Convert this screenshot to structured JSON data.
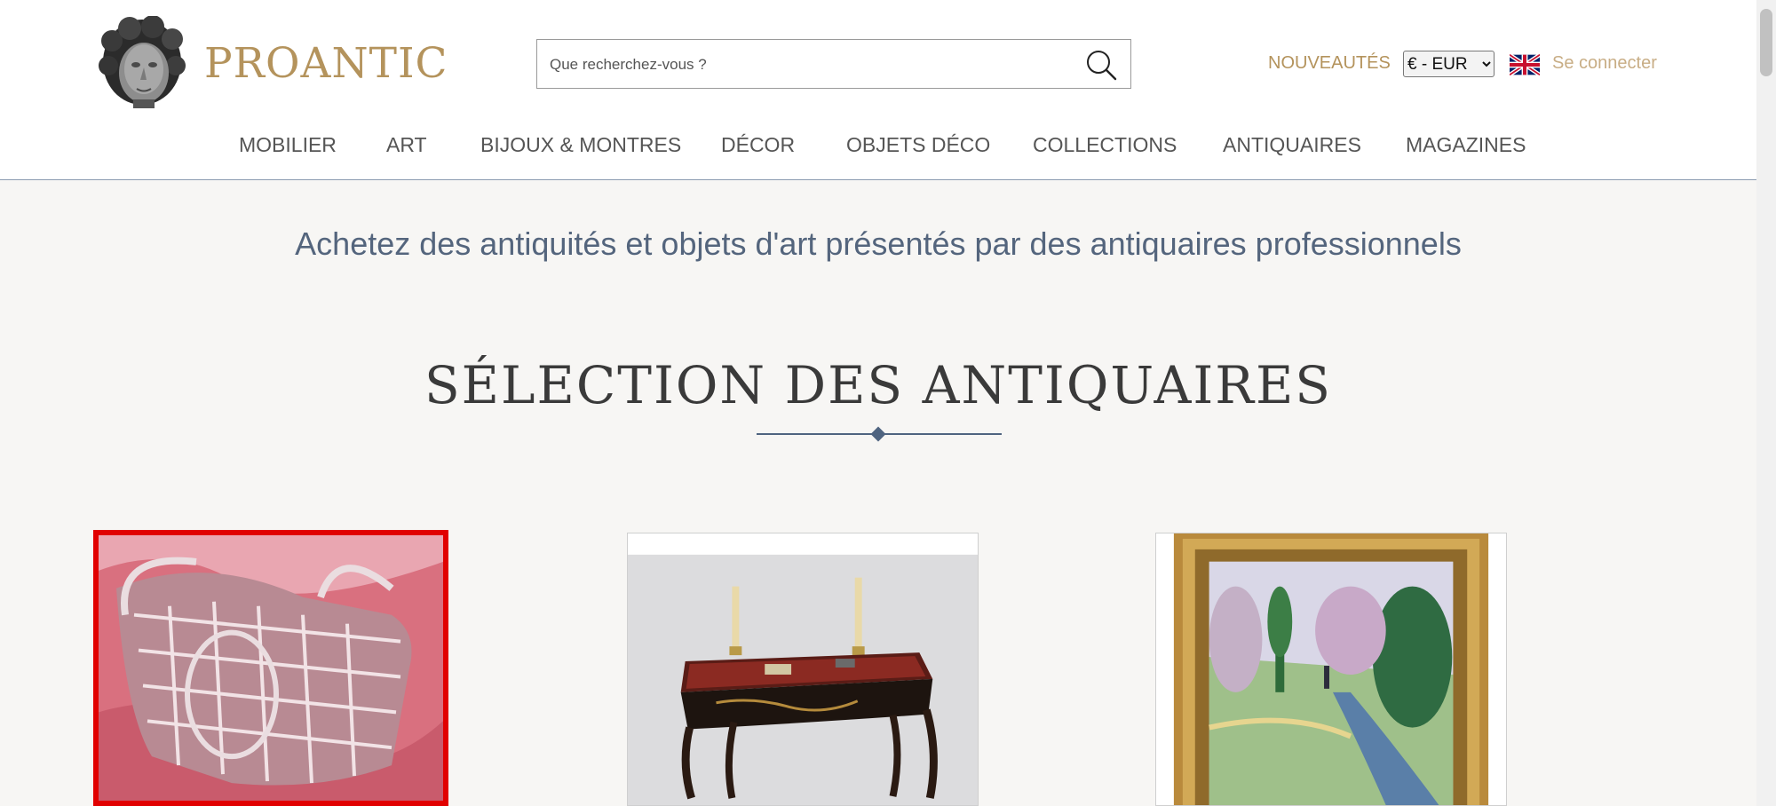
{
  "header": {
    "logo_text": "PROANTIC",
    "search_placeholder": "Que recherchez-vous ?",
    "new_link": "NOUVEAUTÉS",
    "currency": {
      "selected": "€ - EUR",
      "options": [
        "€ - EUR"
      ]
    },
    "language_icon": "uk-flag-icon",
    "login_link": "Se connecter"
  },
  "nav": [
    "MOBILIER",
    "ART",
    "BIJOUX & MONTRES",
    "DÉCOR",
    "OBJETS DÉCO",
    "COLLECTIONS",
    "ANTIQUAIRES",
    "MAGAZINES"
  ],
  "hero": {
    "tagline": "Achetez des antiquités et objets d'art présentés par des antiquaires professionnels",
    "section_title": "SÉLECTION DES ANTIQUAIRES"
  },
  "colors": {
    "gold": "#b4935c",
    "navy": "#4f6480",
    "selected_border": "#e10000",
    "background": "#f7f6f4"
  }
}
